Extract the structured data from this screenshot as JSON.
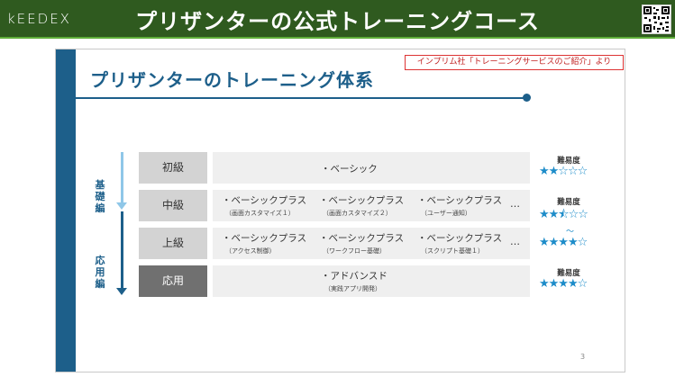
{
  "header": {
    "logo": "kEEDEX",
    "title": "プリザンターの公式トレーニングコース"
  },
  "slide": {
    "title": "プリザンターのトレーニング体系",
    "source": "インプリム社「トレーニングサービスのご紹介」より",
    "side_labels": {
      "basic": "基礎編",
      "applied": "応用編"
    },
    "rows": [
      {
        "level": "初級",
        "items": [
          {
            "name": "・ベーシック",
            "note": ""
          }
        ],
        "difficulty_label": "難易度",
        "stars": "★★☆☆☆"
      },
      {
        "level": "中級",
        "items": [
          {
            "name": "・ベーシックプラス",
            "note": "（画面カスタマイズ１）"
          },
          {
            "name": "・ベーシックプラス",
            "note": "（画面カスタマイズ２）"
          },
          {
            "name": "・ベーシックプラス",
            "note": "（ユーザー通知）"
          }
        ],
        "ellipsis": "…",
        "difficulty_label": "難易度",
        "stars": "★★⯪☆☆"
      },
      {
        "level": "上級",
        "items": [
          {
            "name": "・ベーシックプラス",
            "note": "（アクセス制御）"
          },
          {
            "name": "・ベーシックプラス",
            "note": "（ワークフロー基礎）"
          },
          {
            "name": "・ベーシックプラス",
            "note": "（スクリプト基礎１）"
          }
        ],
        "ellipsis": "…",
        "difficulty_label": "",
        "stars": "★★★★☆"
      },
      {
        "level": "応用",
        "items": [
          {
            "name": "・アドバンスド",
            "note": "（実践アプリ開発）"
          }
        ],
        "difficulty_label": "難易度",
        "stars": "★★★★☆"
      }
    ],
    "tilde": "〜",
    "page_number": "3"
  }
}
